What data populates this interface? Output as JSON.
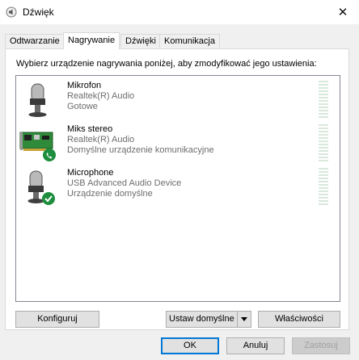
{
  "window": {
    "title": "Dźwięk",
    "close_glyph": "✕"
  },
  "tabs": [
    {
      "label": "Odtwarzanie",
      "active": false
    },
    {
      "label": "Nagrywanie",
      "active": true
    },
    {
      "label": "Dźwięki",
      "active": false
    },
    {
      "label": "Komunikacja",
      "active": false
    }
  ],
  "instruction": "Wybierz urządzenie nagrywania poniżej, aby zmodyfikować jego ustawienia:",
  "devices": [
    {
      "name": "Mikrofon",
      "driver": "Realtek(R) Audio",
      "status": "Gotowe",
      "icon": "microphone-icon"
    },
    {
      "name": "Miks stereo",
      "driver": "Realtek(R) Audio",
      "status": "Domyślne urządzenie komunikacyjne",
      "icon": "sound-card-icon"
    },
    {
      "name": "Microphone",
      "driver": "USB Advanced Audio Device",
      "status": "Urządzenie domyślne",
      "icon": "microphone-icon"
    }
  ],
  "buttons": {
    "configure": "Konfiguruj",
    "set_default": "Ustaw domyślne",
    "properties": "Właściwości",
    "ok": "OK",
    "cancel": "Anuluj",
    "apply": "Zastosuj"
  },
  "colors": {
    "accent": "#0078d7",
    "check_green": "#1e8e3e",
    "status_gray": "#6d6d6d"
  }
}
